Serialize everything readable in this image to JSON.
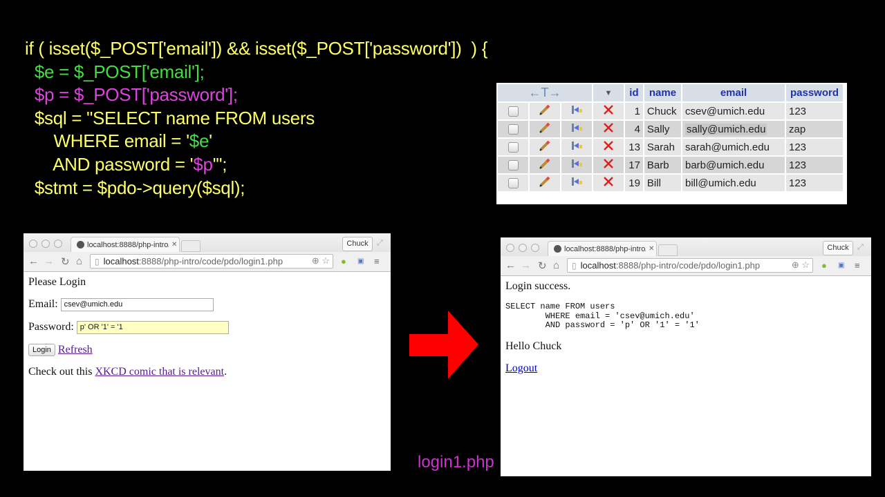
{
  "code": {
    "lines": [
      [
        {
          "t": "if ( isset($_POST['email']) && isset($_POST['password'])  ) {",
          "c": "yel"
        }
      ],
      [
        {
          "t": "  $e = $_POST['email'];",
          "c": "grn"
        }
      ],
      [
        {
          "t": "  $p = $_POST['password'];",
          "c": "mag"
        }
      ],
      [
        {
          "t": "  $sql = \"SELECT name FROM users",
          "c": "yel"
        }
      ],
      [
        {
          "t": "      WHERE email = '",
          "c": "yel"
        },
        {
          "t": "$e",
          "c": "grn"
        },
        {
          "t": "'",
          "c": "yel"
        }
      ],
      [
        {
          "t": "      AND password = '",
          "c": "yel"
        },
        {
          "t": "$p",
          "c": "mag"
        },
        {
          "t": "'\";",
          "c": "yel"
        }
      ],
      [
        {
          "t": "  $stmt = $pdo->query($sql);",
          "c": "yel"
        }
      ]
    ]
  },
  "db_table": {
    "nav_arrows": "←T→",
    "sort_icon": "▼",
    "columns": [
      "id",
      "name",
      "email",
      "password"
    ],
    "rows": [
      {
        "id": "1",
        "name": "Chuck",
        "email": "csev@umich.edu",
        "password": "123"
      },
      {
        "id": "4",
        "name": "Sally",
        "email": "sally@umich.edu",
        "password": "zap"
      },
      {
        "id": "13",
        "name": "Sarah",
        "email": "sarah@umich.edu",
        "password": "123"
      },
      {
        "id": "17",
        "name": "Barb",
        "email": "barb@umich.edu",
        "password": "123"
      },
      {
        "id": "19",
        "name": "Bill",
        "email": "bill@umich.edu",
        "password": "123"
      }
    ],
    "row_icons": [
      "checkbox",
      "pencil-edit-icon",
      "copy-insert-icon",
      "delete-x-icon"
    ]
  },
  "browser_left": {
    "tab_title": "localhost:8888/php-intro/",
    "user_button": "Chuck",
    "url_host": "localhost",
    "url_rest": ":8888/php-intro/code/pdo/login1.php",
    "page": {
      "heading": "Please Login",
      "email_label": "Email:",
      "email_value": "csev@umich.edu",
      "password_label": "Password:",
      "password_value": "p' OR '1' = '1",
      "login_button": "Login",
      "refresh_link": "Refresh",
      "check_text": "Check out this ",
      "xkcd_link": "XKCD comic that is relevant",
      "check_end": "."
    }
  },
  "browser_right": {
    "tab_title": "localhost:8888/php-intro/",
    "user_button": "Chuck",
    "url_host": "localhost",
    "url_rest": ":8888/php-intro/code/pdo/login1.php",
    "page": {
      "status": "Login success.",
      "sql": "SELECT name FROM users\n        WHERE email = 'csev@umich.edu'\n        AND password = 'p' OR '1' = '1'",
      "hello": "Hello Chuck",
      "logout_link": "Logout"
    }
  },
  "caption": "login1.php",
  "colors": {
    "code_yellow": "#ffff66",
    "code_green": "#44dd44",
    "code_magenta": "#dd44dd",
    "arrow": "#ff0000",
    "caption": "#cc33cc",
    "header_blue": "#2233aa"
  }
}
